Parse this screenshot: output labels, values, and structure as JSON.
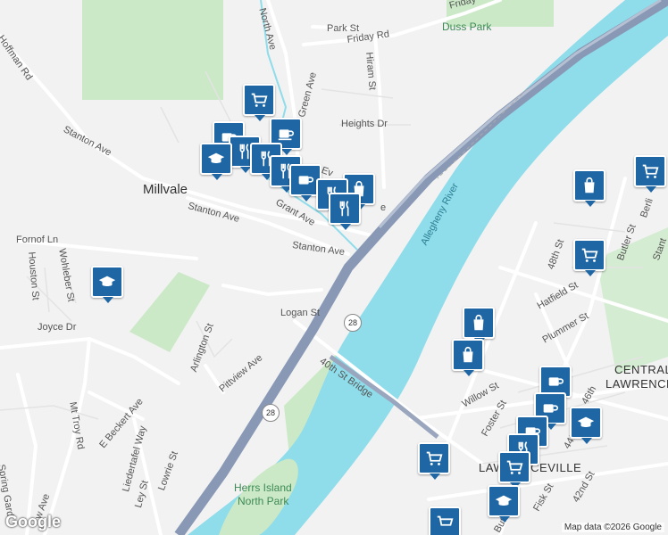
{
  "map": {
    "colors": {
      "land": "#f2f2f2",
      "water": "#8fdcea",
      "park": "#cbe9c7",
      "road": "#ffffff",
      "highway": "#8898b5",
      "poi": "#1e66a4"
    },
    "labels": {
      "place_millvale": "Millvale",
      "place_lawrenceville": "LAWRENCEVILLE",
      "place_central_lawrenceville_1": "CENTRAL",
      "place_central_lawrenceville_2": "LAWRENCEV",
      "park_duss": "Duss Park",
      "park_herrs_1": "Herrs Island",
      "park_herrs_2": "North Park",
      "river": "Allegheny River",
      "bridge": "40th St Bridge",
      "route": "28"
    },
    "streets": {
      "north_ave": "North Ave",
      "park_st": "Park St",
      "friday_rd": "Friday Rd",
      "friday_top": "Friday",
      "hoffman_rd": "Hoffman Rd",
      "green_ave": "Green Ave",
      "hiram_st": "Hiram St",
      "heights_dr": "Heights Dr",
      "stanton_ave_w": "Stanton Ave",
      "stanton_ave_m": "Stanton Ave",
      "stanton_ave_e": "Stanton Ave",
      "grant_ave": "Grant Ave",
      "evergreen": "Ev",
      "ave_frag": "e",
      "fornof_ln": "Fornof Ln",
      "houston_st": "Houston St",
      "wohleber_st": "Wohleber St",
      "logan_st": "Logan St",
      "joyce_dr": "Joyce Dr",
      "arlington_st": "Arlington St",
      "pittview_ave": "Pittview Ave",
      "e_beckert_ave": "E Beckert Ave",
      "mt_troy_rd": "Mt Troy Rd",
      "liedertafel_way": "Liedertafel Way",
      "ley_st": "Ley St",
      "lowrie_st": "Lowrie St",
      "spring_garden": "Spring Gard",
      "w_ave": "w Ave",
      "st_48": "48th St",
      "butler_st": "Butler St",
      "butler_st_s": "Butler",
      "hatfield_st": "Hatfield St",
      "plummer_st": "Plummer St",
      "willow_st": "Willow St",
      "foster_st": "Foster St",
      "st_46": "46th",
      "st_44": "44th",
      "st_42": "42nd St",
      "fisk_st": "Fisk St",
      "berlin": "Berli",
      "stanton_frag": "Stant"
    },
    "attribution": "Map data ©2026 Google",
    "logo": "Google"
  }
}
